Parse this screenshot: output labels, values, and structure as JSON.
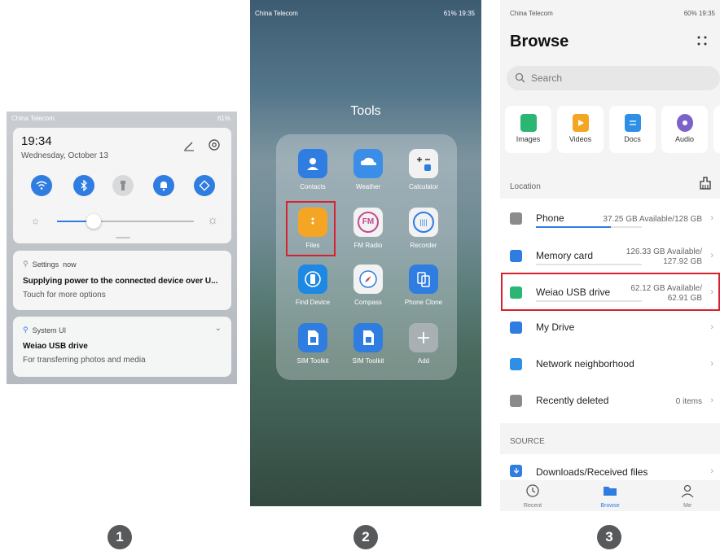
{
  "panel1": {
    "status_left": "China Telecom",
    "status_right": "61%",
    "time": "19:34",
    "date": "Wednesday, October 13",
    "brightness_level": 0.22,
    "notifications": [
      {
        "app": "Settings",
        "when": "now",
        "title": "Supplying power to the connected device over U...",
        "body": "Touch for more options"
      },
      {
        "app": "System UI",
        "when": "",
        "title": "Weiao USB drive",
        "body": "For transferring photos and media"
      }
    ]
  },
  "panel2": {
    "status_left": "China Telecom",
    "status_right": "61%  19:35",
    "folder_title": "Tools",
    "apps": [
      {
        "label": "Contacts",
        "color": "#2f7de1",
        "icon": "contacts-icon"
      },
      {
        "label": "Weather",
        "color": "#3b8ee8",
        "icon": "weather-icon"
      },
      {
        "label": "Calculator",
        "color": "#f2f2f2",
        "icon": "calculator-icon"
      },
      {
        "label": "Files",
        "color": "#f5a524",
        "icon": "files-icon"
      },
      {
        "label": "FM Radio",
        "color": "#f2f2f2",
        "icon": "fm-radio-icon"
      },
      {
        "label": "Recorder",
        "color": "#f2f2f2",
        "icon": "recorder-icon"
      },
      {
        "label": "Find Device",
        "color": "#1e88e5",
        "icon": "find-device-icon"
      },
      {
        "label": "Compass",
        "color": "#f2f2f2",
        "icon": "compass-icon"
      },
      {
        "label": "Phone Clone",
        "color": "#2f7de1",
        "icon": "phone-clone-icon"
      },
      {
        "label": "SIM Toolkit",
        "color": "#2f7de1",
        "icon": "sim-icon"
      },
      {
        "label": "SIM Toolkit",
        "color": "#2f7de1",
        "icon": "sim-icon"
      },
      {
        "label": "Add",
        "color": "#a9b0b4",
        "icon": "add-icon"
      }
    ]
  },
  "panel3": {
    "status_left": "China Telecom",
    "status_right": "60%  19:35",
    "title": "Browse",
    "search_placeholder": "Search",
    "categories": [
      {
        "label": "Images",
        "color": "#2bb673"
      },
      {
        "label": "Videos",
        "color": "#f5a524"
      },
      {
        "label": "Docs",
        "color": "#2f8fe6"
      },
      {
        "label": "Audio",
        "color": "#7b61c9"
      }
    ],
    "location_label": "Location",
    "rows": [
      {
        "name": "Phone",
        "value": "37.25 GB Available/128 GB",
        "value2": "",
        "used": 0.71,
        "color": "#8b8b8b"
      },
      {
        "name": "Memory card",
        "value": "126.33 GB Available/",
        "value2": "127.92 GB",
        "used": 0.0,
        "color": "#2f7de1"
      },
      {
        "name": "Weiao USB drive",
        "value": "62.12 GB Available/",
        "value2": "62.91 GB",
        "used": 0.0,
        "color": "#2bb673"
      },
      {
        "name": "My Drive",
        "value": "",
        "value2": "",
        "color": "#2f7de1"
      },
      {
        "name": "Network neighborhood",
        "value": "",
        "value2": "",
        "color": "#2f8fe6"
      },
      {
        "name": "Recently deleted",
        "value": "0 items",
        "value2": "",
        "color": "#8b8b8b"
      }
    ],
    "source_label": "SOURCE",
    "source_row": "Downloads/Received files",
    "nav": [
      {
        "label": "Recent"
      },
      {
        "label": "Browse"
      },
      {
        "label": "Me"
      }
    ]
  },
  "steps": [
    "1",
    "2",
    "3"
  ]
}
